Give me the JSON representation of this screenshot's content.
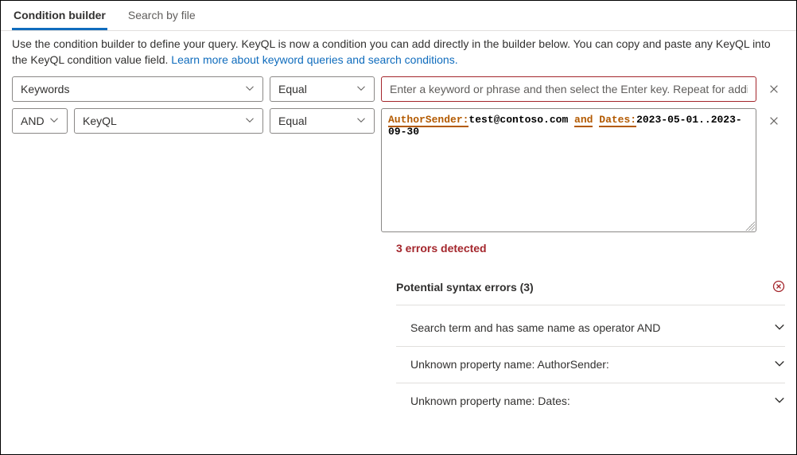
{
  "tabs": {
    "builder": "Condition builder",
    "byfile": "Search by file"
  },
  "intro": {
    "text1": "Use the condition builder to define your query. KeyQL is now a condition you can add directly in the builder below. You can copy and paste any KeyQL into the KeyQL condition value field. ",
    "link": "Learn more about keyword queries and search conditions."
  },
  "row1": {
    "field": "Keywords",
    "op": "Equal",
    "placeholder": "Enter a keyword or phrase and then select the Enter key. Repeat for additional…"
  },
  "row2": {
    "bool": "AND",
    "field": "KeyQL",
    "op": "Equal",
    "kql": {
      "p1": "AuthorSender:",
      "v1": "test@contoso.com ",
      "op": "and",
      "sp": " ",
      "p2": "Dates:",
      "v2": "2023-05-01..2023-09-30"
    }
  },
  "errors": {
    "heading": "3 errors detected",
    "category": "Potential syntax errors (3)",
    "items": [
      "Search term and has same name as operator AND",
      "Unknown property name: AuthorSender:",
      "Unknown property name: Dates:"
    ]
  }
}
